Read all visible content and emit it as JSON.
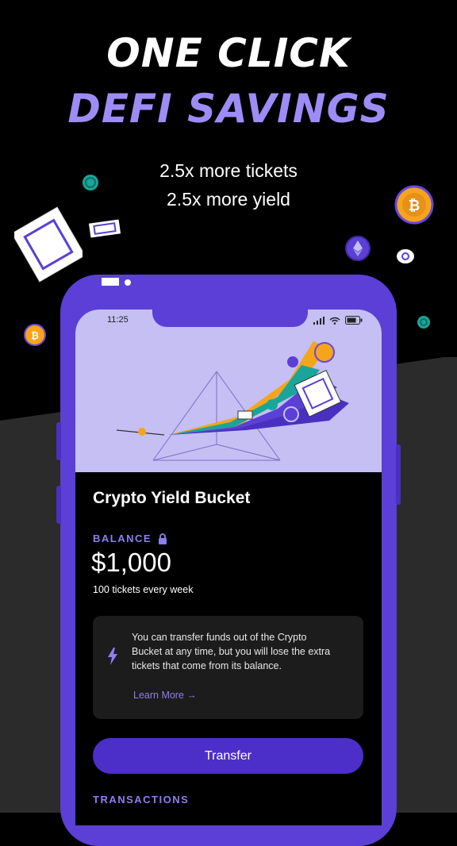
{
  "headline": {
    "line1": "ONE CLICK",
    "line2": "DEFI SAVINGS",
    "sub1": "2.5x more tickets",
    "sub2": "2.5x more yield"
  },
  "status_bar": {
    "time": "11:25",
    "icons": [
      "signal-icon",
      "wifi-icon",
      "battery-icon"
    ]
  },
  "card": {
    "title": "Crypto Yield Bucket",
    "balance_label": "BALANCE",
    "balance_value": "$1,000",
    "tickets": "100 tickets every week",
    "info_text": "You can transfer funds out of the Crypto Bucket at any time, but you will lose the extra tickets that come from its balance.",
    "learn_more": "Learn More →",
    "transfer_label": "Transfer",
    "transactions_label": "TRANSACTIONS"
  },
  "colors": {
    "accent": "#9d8cf6",
    "phone": "#5b3fd6",
    "button": "#4c2fc8",
    "hero_bg": "#c5bff3"
  }
}
